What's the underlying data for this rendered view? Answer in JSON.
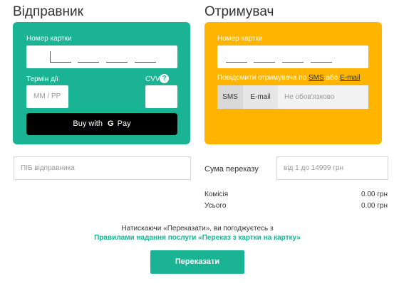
{
  "sender": {
    "heading": "Відправник",
    "card_number_label": "Номер картки",
    "expiry_label": "Термін дії",
    "expiry_placeholder": "ММ / РР",
    "cvv_label": "CVV",
    "cvv_help_glyph": "?",
    "gpay_prefix": "Buy with",
    "gpay_g": "G",
    "gpay_suffix": "Pay",
    "name_placeholder": "ПІБ відправника",
    "card_color": "#1ab394"
  },
  "receiver": {
    "heading": "Отримувач",
    "card_number_label": "Номер картки",
    "notify_prefix": "Повідомити отримувача по",
    "notify_sms": "SMS",
    "notify_or": "або",
    "notify_email": "E-mail",
    "sms_option": "SMS",
    "email_option": "E-mail",
    "contact_placeholder": "Не обов'язково",
    "card_color": "#ffb400"
  },
  "amount": {
    "label": "Сума переказу",
    "placeholder": "від 1 до 14999 грн"
  },
  "summary": {
    "commission_label": "Комісія",
    "commission_value": "0.00 грн",
    "total_label": "Усього",
    "total_value": "0.00 грн"
  },
  "footer": {
    "consent_text": "Натискаючи «Переказати», ви погоджуєтесь з",
    "rules_link": "Правилами надання послуги «Переказ з картки на картку»",
    "transfer_button": "Переказати",
    "accent": "#1ab394"
  }
}
